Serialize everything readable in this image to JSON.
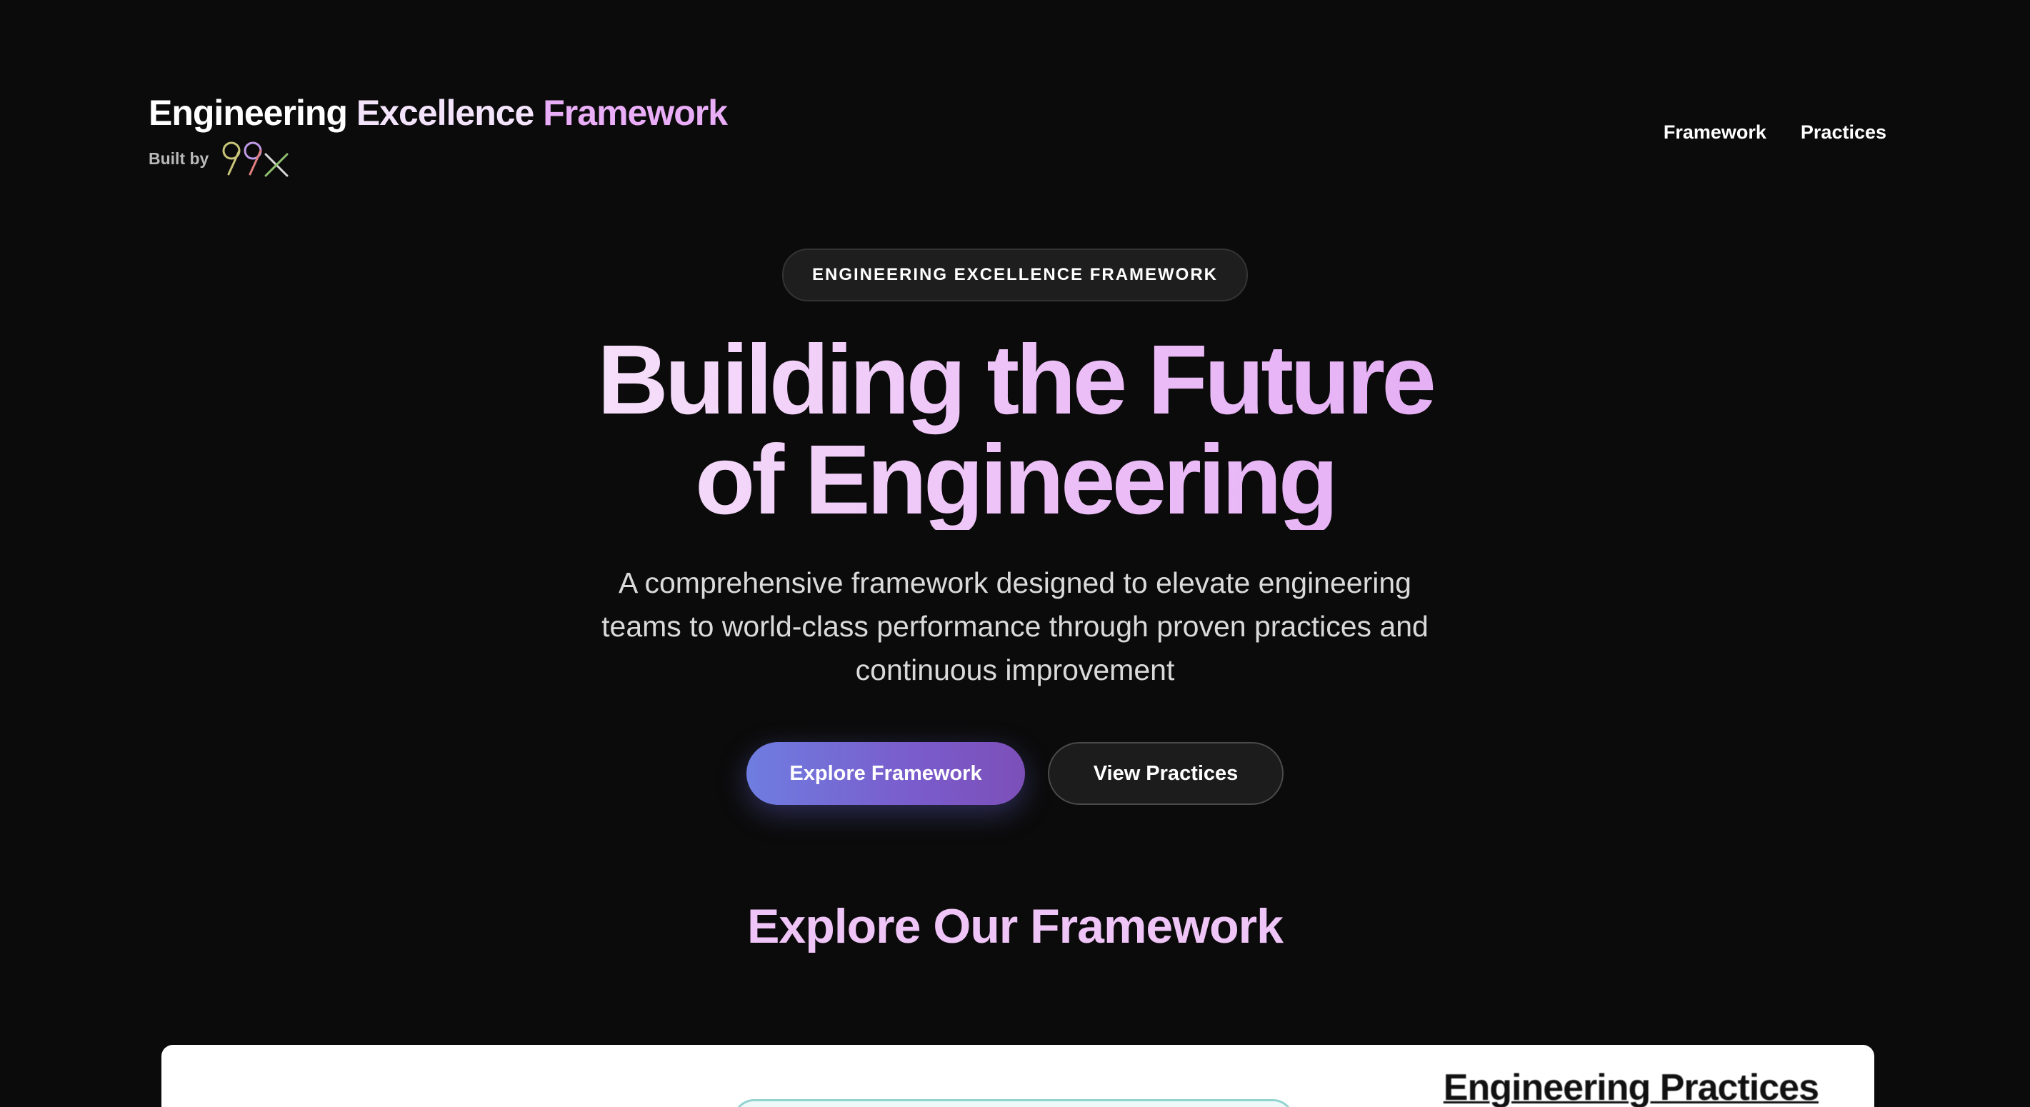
{
  "header": {
    "title_words": [
      "Engineering",
      "Excellence",
      "Framework"
    ],
    "built_by_label": "Built by",
    "logo_name": "99x"
  },
  "nav": {
    "items": [
      "Framework",
      "Practices"
    ]
  },
  "hero": {
    "badge": "ENGINEERING EXCELLENCE FRAMEWORK",
    "title_line1": "Building the Future",
    "title_line2": "of Engineering",
    "subtitle": "A comprehensive framework designed to elevate engineering teams to world-class performance through proven practices and continuous improvement",
    "primary_cta": "Explore Framework",
    "secondary_cta": "View Practices"
  },
  "explore": {
    "title": "Explore Our Framework",
    "preview_heading": "Engineering Practices"
  },
  "colors": {
    "background": "#0b0b0b",
    "accent_pink": "#e9aef7",
    "cta_gradient_start": "#6f7de0",
    "cta_gradient_end": "#7c4fb8"
  }
}
